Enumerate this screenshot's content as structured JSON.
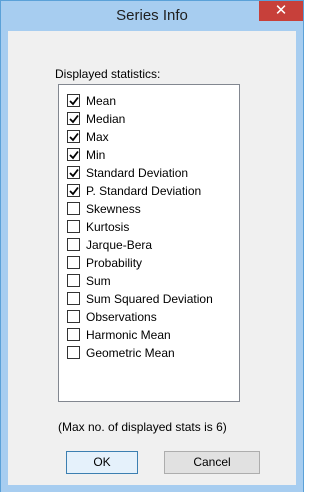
{
  "window": {
    "title": "Series Info",
    "close_glyph": "✕"
  },
  "stats": {
    "section_label": "Displayed statistics:",
    "items": [
      {
        "label": "Mean",
        "checked": true
      },
      {
        "label": "Median",
        "checked": true
      },
      {
        "label": "Max",
        "checked": true
      },
      {
        "label": "Min",
        "checked": true
      },
      {
        "label": "Standard Deviation",
        "checked": true
      },
      {
        "label": "P. Standard Deviation",
        "checked": true
      },
      {
        "label": "Skewness",
        "checked": false
      },
      {
        "label": "Kurtosis",
        "checked": false
      },
      {
        "label": "Jarque-Bera",
        "checked": false
      },
      {
        "label": "Probability",
        "checked": false
      },
      {
        "label": "Sum",
        "checked": false
      },
      {
        "label": "Sum Squared Deviation",
        "checked": false
      },
      {
        "label": "Observations",
        "checked": false
      },
      {
        "label": "Harmonic Mean",
        "checked": false
      },
      {
        "label": "Geometric Mean",
        "checked": false
      }
    ],
    "note": "(Max no. of displayed stats is 6)"
  },
  "buttons": {
    "ok_label": "OK",
    "cancel_label": "Cancel"
  },
  "colors": {
    "title_bar": "#a7cdf0",
    "close_button": "#c7403a",
    "dialog_bg": "#f0f0f0"
  }
}
